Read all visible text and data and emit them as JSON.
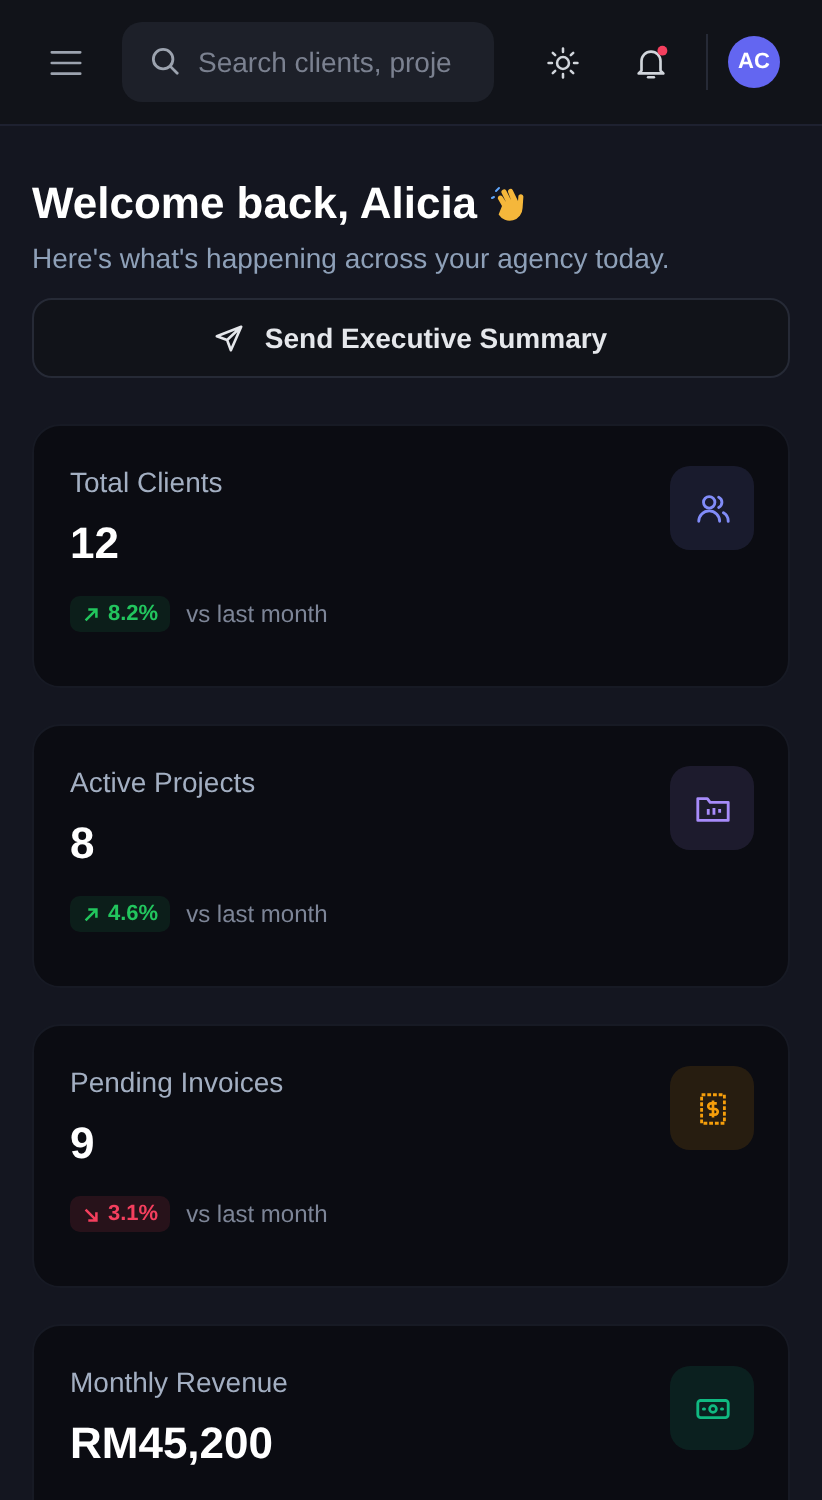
{
  "header": {
    "search": {
      "placeholder": "Search clients, proje"
    },
    "notifications": {
      "unread": true
    },
    "avatar": {
      "initials": "AC"
    }
  },
  "welcome": {
    "title": "Welcome back, Alicia",
    "subtitle": "Here's what's happening across your agency today."
  },
  "action_button": {
    "label": "Send Executive Summary"
  },
  "stats": [
    {
      "label": "Total Clients",
      "value": "12",
      "kind": "users",
      "color": "#818cf8",
      "change": {
        "kind": "up",
        "value": "8.2%",
        "caption": "vs last month"
      }
    },
    {
      "label": "Active Projects",
      "value": "8",
      "kind": "folder",
      "color": "#a78bfa",
      "change": {
        "kind": "up",
        "value": "4.6%",
        "caption": "vs last month"
      }
    },
    {
      "label": "Pending Invoices",
      "value": "9",
      "kind": "invoice",
      "color": "#f59e0b",
      "change": {
        "kind": "down",
        "value": "3.1%",
        "caption": "vs last month"
      }
    },
    {
      "label": "Monthly Revenue",
      "value": "RM45,200",
      "kind": "cash",
      "color": "#10b981"
    }
  ]
}
